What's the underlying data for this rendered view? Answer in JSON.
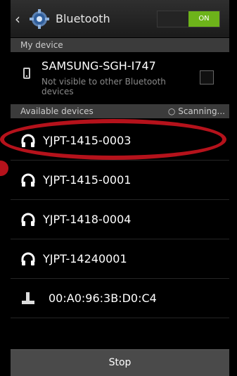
{
  "header": {
    "title": "Bluetooth",
    "toggle_label": "ON"
  },
  "my_device": {
    "section_label": "My device",
    "name": "SAMSUNG-SGH-I747",
    "status": "Not visible to other Bluetooth devices"
  },
  "available": {
    "section_label": "Available devices",
    "scanning_label": "Scanning...",
    "devices": [
      {
        "name": "YJPT-1415-0003",
        "icon": "headphones-icon"
      },
      {
        "name": "YJPT-1415-0001",
        "icon": "headphones-icon"
      },
      {
        "name": "YJPT-1418-0004",
        "icon": "headphones-icon"
      },
      {
        "name": "YJPT-14240001",
        "icon": "headphones-icon"
      },
      {
        "name": "00:A0:96:3B:D0:C4",
        "icon": "joystick-icon"
      }
    ]
  },
  "footer": {
    "stop_label": "Stop"
  },
  "colors": {
    "accent_green": "#6db31a",
    "highlight_red": "#b5121b"
  }
}
